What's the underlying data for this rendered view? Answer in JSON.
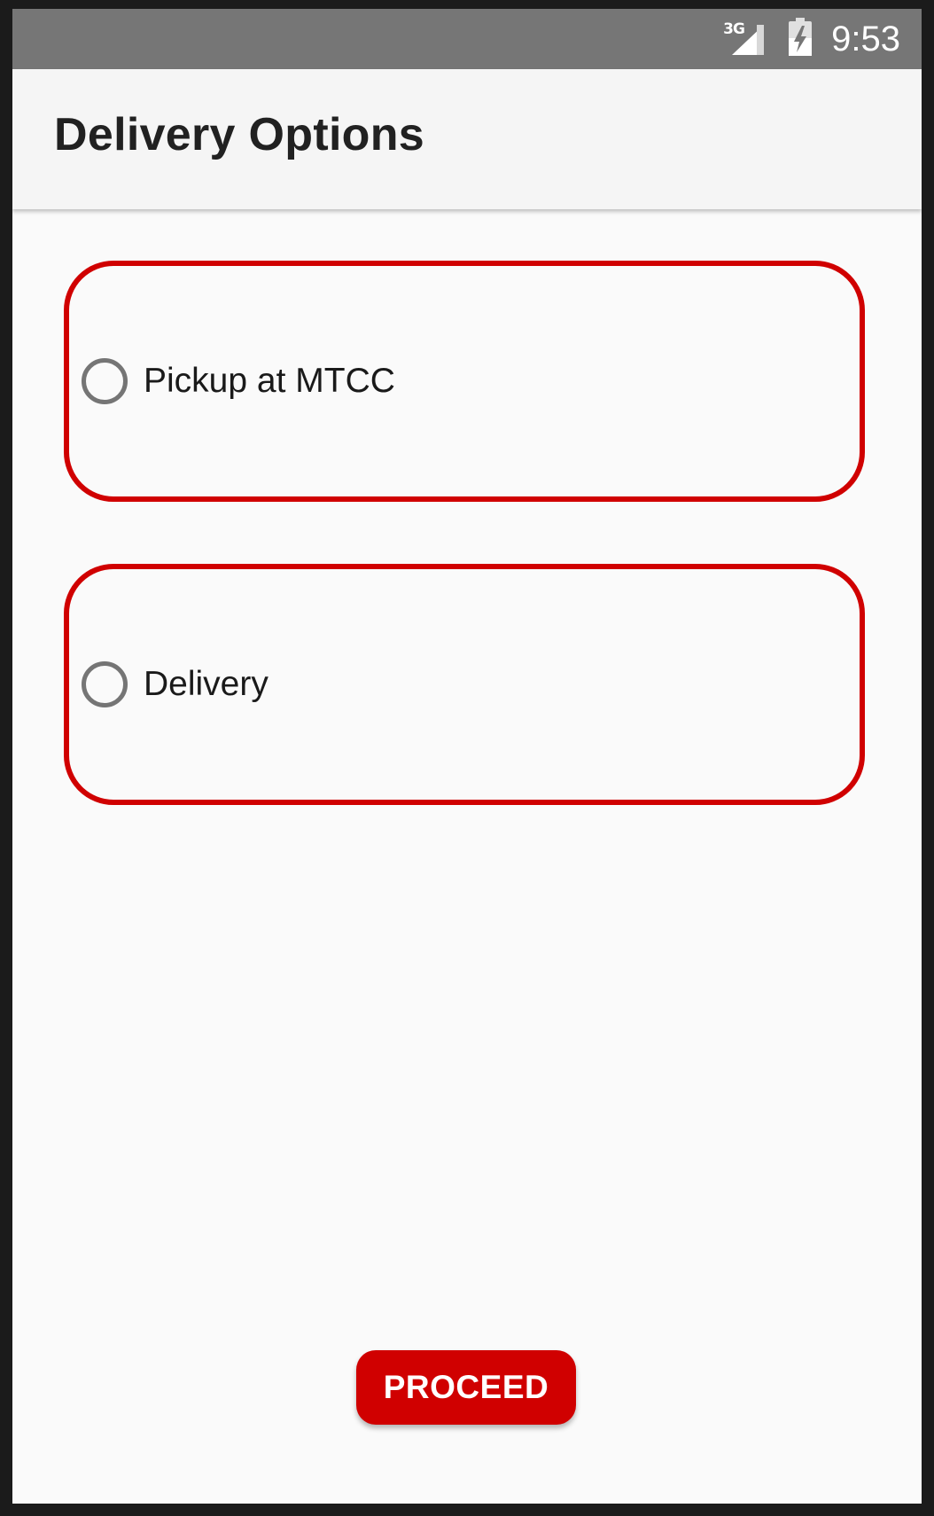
{
  "status_bar": {
    "network_type": "3G",
    "time": "9:53",
    "icons": [
      "signal-icon",
      "battery-charging-icon"
    ]
  },
  "toolbar": {
    "title": "Delivery Options"
  },
  "options": [
    {
      "label": "Pickup at MTCC",
      "selected": false
    },
    {
      "label": "Delivery",
      "selected": false
    }
  ],
  "actions": {
    "proceed_label": "PROCEED"
  },
  "colors": {
    "accent": "#d00000",
    "status_bar": "#767676",
    "toolbar": "#f5f5f5",
    "background": "#fafafa",
    "radio_unchecked": "#757575"
  }
}
